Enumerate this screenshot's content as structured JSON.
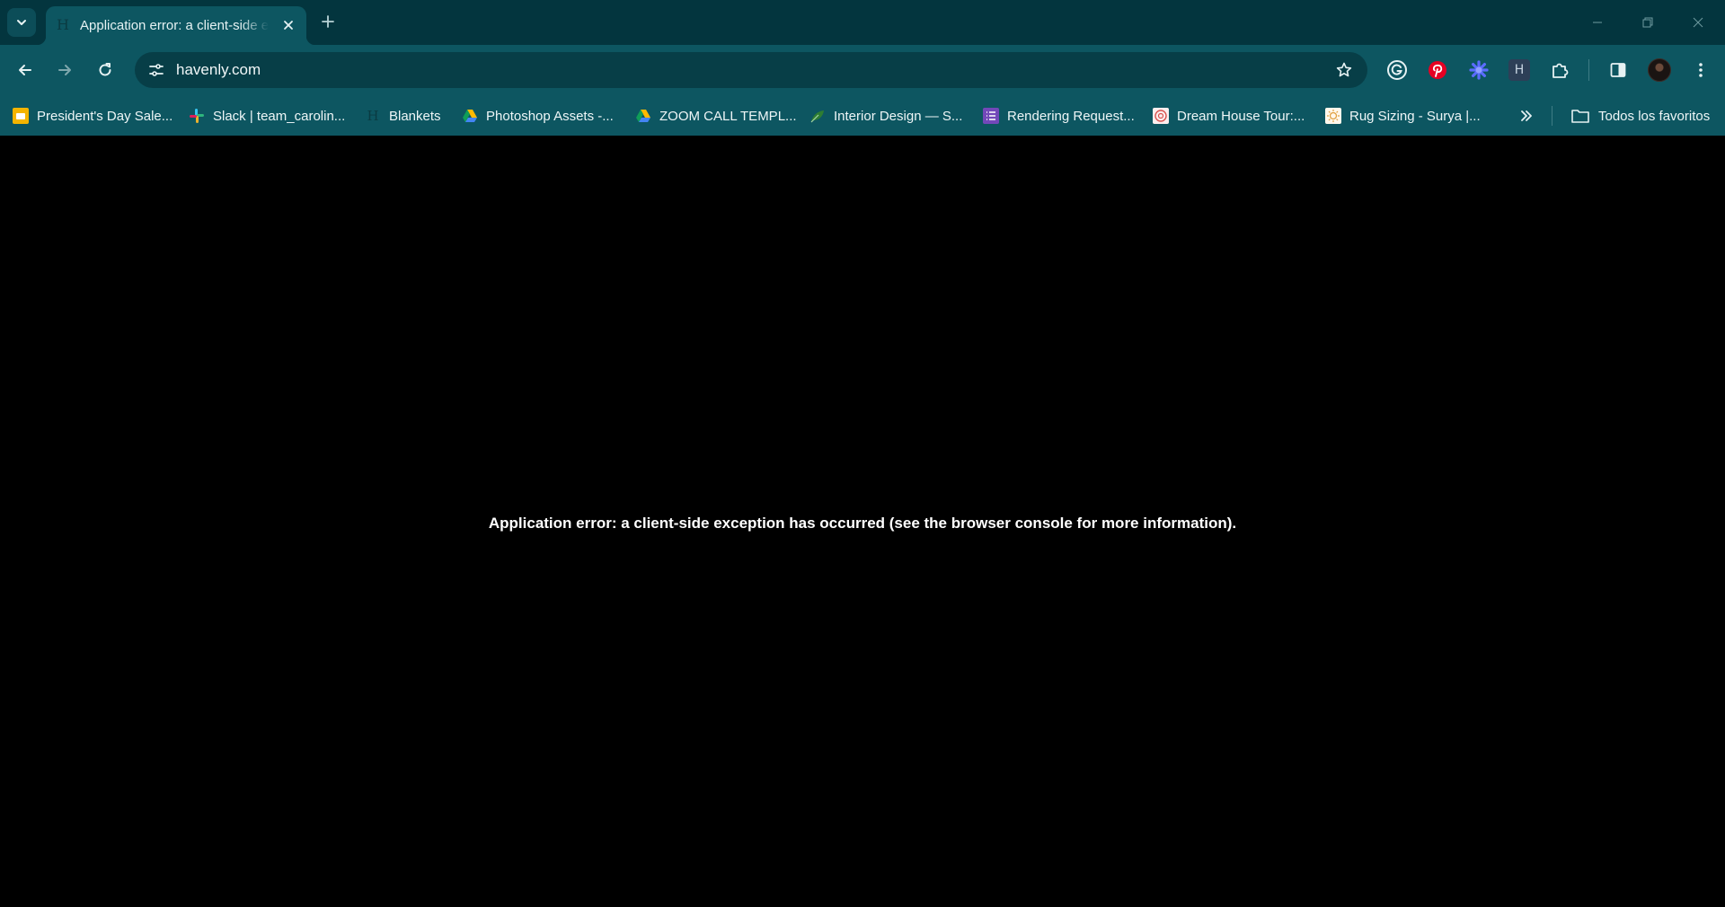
{
  "tabs": [
    {
      "title": "Application error: a client-side exception has occurred",
      "favicon": "havenly-h-icon",
      "favicon_glyph": "H",
      "close_icon": "close-icon"
    }
  ],
  "tabstrip": {
    "search_tabs_icon": "chevron-down-icon",
    "new_tab_icon": "plus-icon"
  },
  "window_controls": [
    "minimize-icon",
    "restore-icon",
    "close-icon"
  ],
  "toolbar": {
    "back_icon": "arrow-left-icon",
    "forward_icon": "arrow-right-icon",
    "reload_icon": "reload-icon",
    "site_info_icon": "tune-icon",
    "url": "havenly.com",
    "bookmark_icon": "star-icon",
    "extensions": [
      {
        "name": "grammarly-icon",
        "color": "#1ba391",
        "glyph": "G"
      },
      {
        "name": "pinterest-icon",
        "color": "#e60023",
        "glyph": "P"
      },
      {
        "name": "flower-extension-icon",
        "color": "#4b5cff"
      },
      {
        "name": "havenly-extension-icon",
        "color": "#2d3f57",
        "glyph": "H"
      },
      {
        "name": "puzzle-icon"
      }
    ],
    "side_panel_icon": "side-panel-icon",
    "profile_icon": "avatar",
    "menu_icon": "kebab-menu-icon"
  },
  "bookmarks": [
    {
      "label": "President's Day Sale...",
      "icon": "google-slides-icon",
      "color": "#f4b400"
    },
    {
      "label": "Slack | team_carolin...",
      "icon": "slack-icon",
      "color": "#e01e5a"
    },
    {
      "label": "Blankets",
      "icon": "havenly-h-icon",
      "color": "#0a3b42",
      "glyph": "H"
    },
    {
      "label": "Photoshop Assets -...",
      "icon": "google-drive-icon",
      "color": "#4285f4"
    },
    {
      "label": "ZOOM CALL TEMPL...",
      "icon": "google-drive-icon",
      "color": "#4285f4"
    },
    {
      "label": "Interior Design — S...",
      "icon": "leaf-icon",
      "color": "#2e7d32"
    },
    {
      "label": "Rendering Request...",
      "icon": "form-list-icon",
      "color": "#7248b9"
    },
    {
      "label": "Dream House Tour:...",
      "icon": "badge-icon",
      "color": "#d9534f"
    },
    {
      "label": "Rug Sizing - Surya |...",
      "icon": "surya-icon",
      "color": "#e0a040"
    }
  ],
  "bookmarks_overflow_icon": "double-chevron-right-icon",
  "all_bookmarks": {
    "label": "Todos los favoritos",
    "icon": "folder-icon"
  },
  "page": {
    "error_message": "Application error: a client-side exception has occurred (see the browser console for more information)."
  }
}
